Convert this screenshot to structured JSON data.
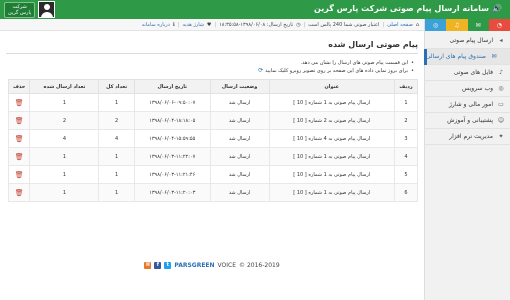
{
  "app": {
    "title": "سامانه ارسال پیام صوتی شرکت پارس گرین",
    "user_label": "شرکت",
    "user_name": "پارس گرین"
  },
  "infobar": {
    "home": "صفحه اصلی",
    "credit": "اعتبار صوتی شما 240 پالس است",
    "datetime": "تاریخ ارسال: ۱۳۹۸/۰۶/۰۸-۱۸:۳۵:۵۸",
    "gift_charge": "شارژ هدیه",
    "about": "درباره سامانه"
  },
  "sidebar": {
    "color_tabs": [
      {
        "icon": "globe-icon",
        "color": "#3ba1d6"
      },
      {
        "icon": "headphones-icon",
        "color": "#f0b323"
      },
      {
        "icon": "bullhorn-icon",
        "color": "#2e9a47"
      },
      {
        "icon": "pie-chart-icon",
        "color": "#e74c3c"
      }
    ],
    "items": [
      {
        "label": "ارسال پیام صوتی",
        "icon": "arrow-left-icon",
        "active": false,
        "sub": false
      },
      {
        "label": "صندوق پیام های ارسالی",
        "icon": "envelope-icon",
        "active": true,
        "sub": true
      },
      {
        "label": "فایل های صوتی",
        "icon": "volume-icon",
        "active": false,
        "sub": false
      },
      {
        "label": "وب سرویس",
        "icon": "globe-icon",
        "active": false,
        "sub": false
      },
      {
        "label": "امور مالی و شارژ",
        "icon": "credit-card-icon",
        "active": false,
        "sub": false
      },
      {
        "label": "پشتیبانی و آموزش",
        "icon": "support-icon",
        "active": false,
        "sub": false
      },
      {
        "label": "مدیریت نرم افزار",
        "icon": "lightbulb-icon",
        "active": false,
        "sub": false
      }
    ]
  },
  "main": {
    "title": "پیام صوتی ارسال شده",
    "notes": [
      "این قسمت پیام صوتی های ارسال را نشان می دهد.",
      "برای بروز نمایی داده های این صفحه بر روی تصویر روبرو کلیک نمایید"
    ],
    "table": {
      "headers": [
        "ردیف",
        "عنوان",
        "وضعیت ارسال",
        "تاریخ ارسال",
        "تعداد کل",
        "تعداد ارسال شده",
        "حذف"
      ],
      "rows": [
        {
          "row": "1",
          "title": "ارسال پیام صوتی به 1 شماره [ 10 ]",
          "status": "ارسال شد",
          "date": "۱۳۹۸/۰۶/۰۶-۰۹:۵۰:۰۷",
          "total": "1",
          "sent": "1"
        },
        {
          "row": "2",
          "title": "ارسال پیام صوتی به 2 شماره [ 10 ]",
          "status": "ارسال شد",
          "date": "۱۳۹۸/۰۶/۰۴-۱۸:۱۸:۰۵",
          "total": "2",
          "sent": "2"
        },
        {
          "row": "3",
          "title": "ارسال پیام صوتی به 4 شماره [ 10 ]",
          "status": "ارسال شد",
          "date": "۱۳۹۸/۰۶/۰۴-۱۵:۵۹:۵۵",
          "total": "4",
          "sent": "4"
        },
        {
          "row": "4",
          "title": "ارسال پیام صوتی به 1 شماره [ 10 ]",
          "status": "ارسال شد",
          "date": "۱۳۹۸/۰۶/۰۳-۱۱:۲۲:۰۷",
          "total": "1",
          "sent": "1"
        },
        {
          "row": "5",
          "title": "ارسال پیام صوتی به 1 شماره [ 10 ]",
          "status": "ارسال شد",
          "date": "۱۳۹۸/۰۶/۰۳-۱۱:۲۱:۴۶",
          "total": "1",
          "sent": "1"
        },
        {
          "row": "6",
          "title": "ارسال پیام صوتی به 1 شماره [ 10 ]",
          "status": "ارسال شد",
          "date": "۱۳۹۸/۰۶/۰۳-۱۱:۲۰:۰۳",
          "total": "1",
          "sent": "1"
        }
      ]
    }
  },
  "footer": {
    "brand": "PARSGREEN",
    "product": "VOICE",
    "years": "© 2016-2019"
  }
}
